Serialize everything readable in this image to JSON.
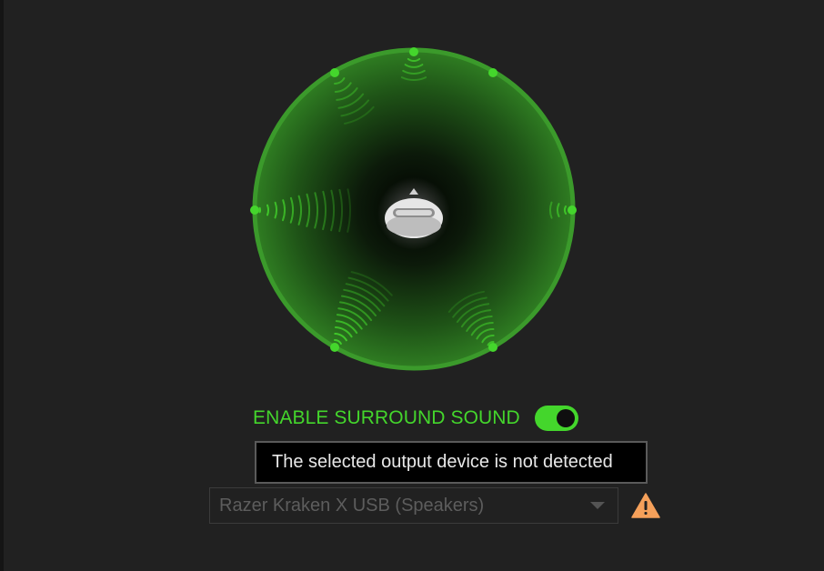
{
  "surround": {
    "label": "ENABLE SURROUND SOUND",
    "enabled": true,
    "accent_color": "#44d62c",
    "speakers": [
      "front-center",
      "front-left",
      "front-right",
      "side-left",
      "side-right",
      "rear-left",
      "rear-right"
    ],
    "center_icon": "headset-icon"
  },
  "tooltip": {
    "text": "The selected output device is not detected"
  },
  "output_device": {
    "selected": "Razer Kraken X USB (Speakers)",
    "warning_icon": "warning-icon",
    "warning_color": "#f5a05a"
  }
}
